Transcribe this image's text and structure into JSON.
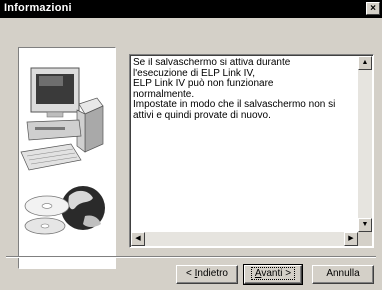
{
  "window": {
    "title": "Informazioni",
    "close_glyph": "×"
  },
  "message": {
    "text": "Se il salvaschermo si attiva durante\nl'esecuzione di ELP Link IV,\nELP Link IV può non funzionare\nnormalmente.\nImpostate in modo che il salvaschermo non si\nattivi e quindi provate di nuovo."
  },
  "scrollbar": {
    "up": "▲",
    "down": "▼",
    "left": "◀",
    "right": "▶"
  },
  "buttons": {
    "back_prefix": "< ",
    "back_accel": "I",
    "back_rest": "ndietro",
    "next_accel": "A",
    "next_rest": "vanti >",
    "cancel": "Annulla"
  },
  "illustration": {
    "icon": "computer-with-cds-icon"
  }
}
